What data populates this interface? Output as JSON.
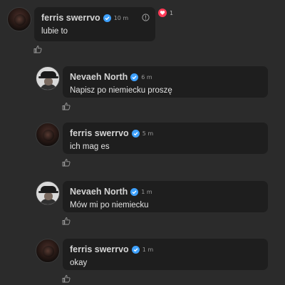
{
  "comments": [
    {
      "author": "ferris swerrvo",
      "time": "10 m",
      "text": "lubie to"
    },
    {
      "author": "Nevaeh North",
      "time": "6 m",
      "text": "Napisz po niemiecku proszę"
    },
    {
      "author": "ferris swerrvo",
      "time": "5 m",
      "text": "ich mag es"
    },
    {
      "author": "Nevaeh North",
      "time": "1 m",
      "text": "Mów mi po niemiecku"
    },
    {
      "author": "ferris swerrvo",
      "time": "1 m",
      "text": "okay"
    }
  ],
  "reaction": {
    "icon": "heart-icon",
    "count": "1",
    "color": "#ff3b57"
  },
  "colors": {
    "background": "#2b2b2b",
    "bubble": "#1e1e1e",
    "verified": "#3ea1ff"
  }
}
